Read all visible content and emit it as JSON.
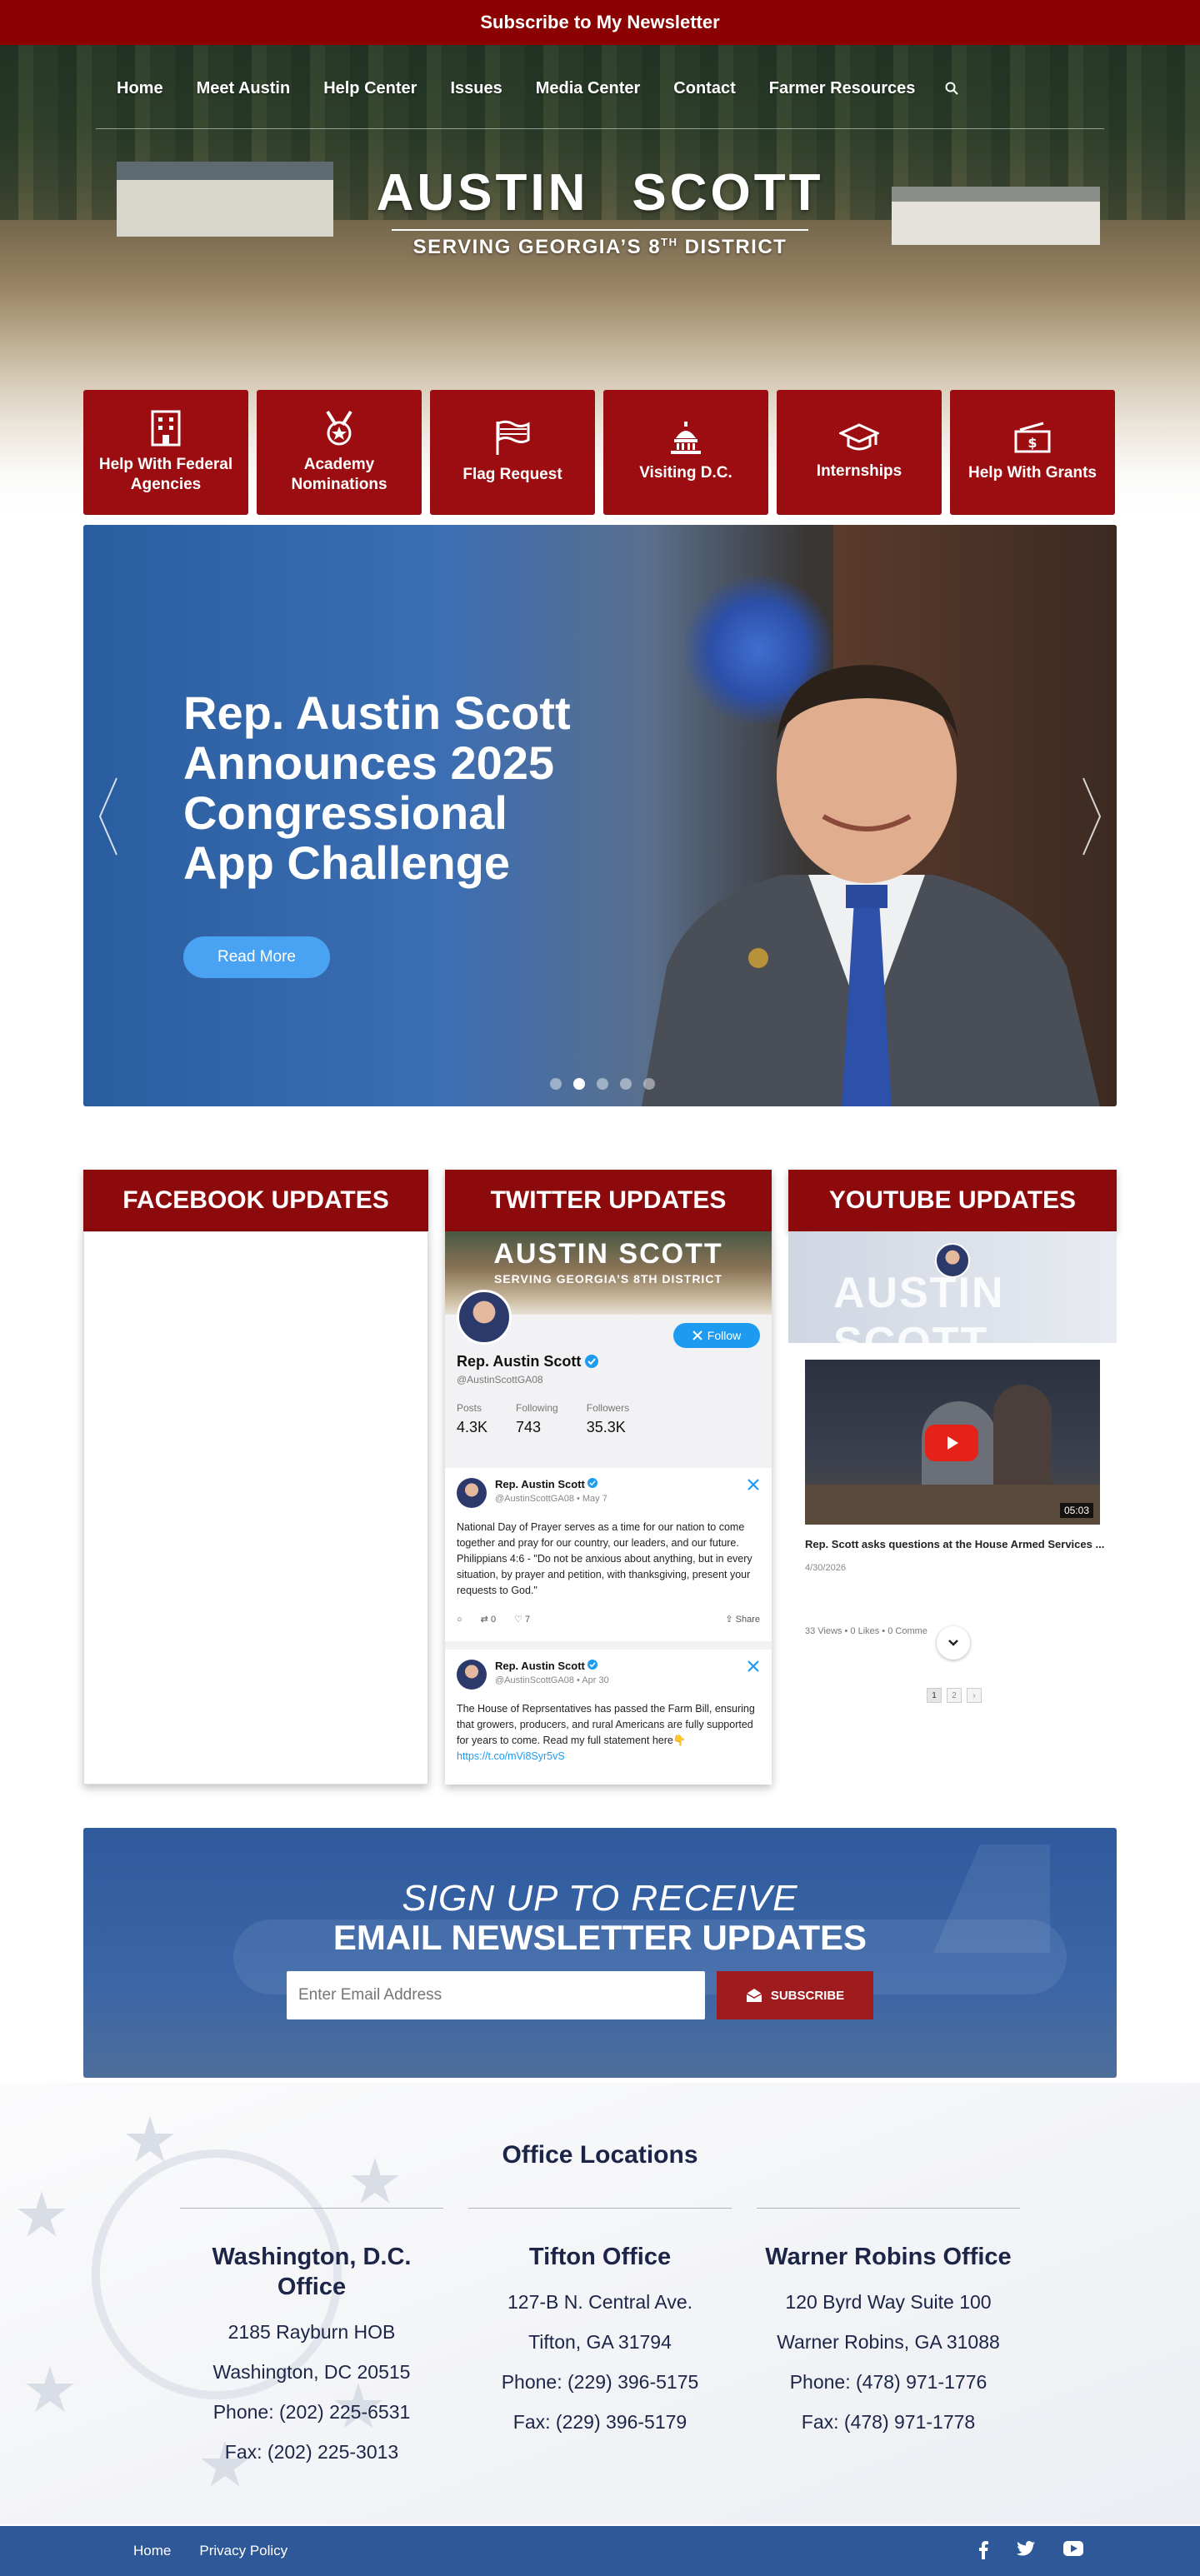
{
  "topbar": {
    "label": "Subscribe to My Newsletter"
  },
  "nav": {
    "items": [
      "Home",
      "Meet Austin",
      "Help Center",
      "Issues",
      "Media Center",
      "Contact",
      "Farmer Resources"
    ],
    "search_icon": "search-icon"
  },
  "logo": {
    "first": "AUSTIN",
    "last": "SCOTT",
    "tagline_pre": "SERVING GEORGIA’S 8",
    "tagline_sup": "TH",
    "tagline_post": " DISTRICT"
  },
  "quick_links": [
    {
      "label": "Help With Federal Agencies",
      "icon": "building-icon"
    },
    {
      "label": "Academy Nominations",
      "icon": "medal-icon"
    },
    {
      "label": "Flag Request",
      "icon": "flag-icon"
    },
    {
      "label": "Visiting D.C.",
      "icon": "capitol-icon"
    },
    {
      "label": "Internships",
      "icon": "graduation-cap-icon"
    },
    {
      "label": "Help With Grants",
      "icon": "money-icon"
    }
  ],
  "slider": {
    "title": "Rep. Austin Scott Announces 2025 Congressional App Challenge",
    "button": "Read More",
    "slide_count": 5,
    "active_slide": 2
  },
  "columns": {
    "facebook": "FACEBOOK UPDATES",
    "twitter": "TWITTER UPDATES",
    "youtube": "YOUTUBE UPDATES"
  },
  "twitter": {
    "banner_first": "AUSTIN",
    "banner_last": "SCOTT",
    "banner_tagline": "SERVING GEORGIA’S 8TH DISTRICT",
    "follow": "Follow",
    "name": "Rep. Austin Scott",
    "handle": "@AustinScottGA08",
    "stats": [
      {
        "label": "Posts",
        "value": "4.3K"
      },
      {
        "label": "Following",
        "value": "743"
      },
      {
        "label": "Followers",
        "value": "35.3K"
      }
    ],
    "tweets": [
      {
        "name": "Rep. Austin Scott",
        "meta": "@AustinScottGA08 • May 7",
        "text": "National Day of Prayer serves as a time for our nation to come together and pray for our country, our leaders, and our future. Philippians 4:6 - \"Do not be anxious about anything, but in every situation, by prayer and petition, with thanksgiving, present your requests to God.\"",
        "link": "",
        "retweets": "0",
        "likes": "7",
        "share": "Share"
      },
      {
        "name": "Rep. Austin Scott",
        "meta": "@AustinScottGA08 • Apr 30",
        "text": "The House of Reprsentatives has passed the Farm Bill, ensuring that growers, producers, and rural Americans are fully supported for years to come. Read my full statement here👇",
        "link": "https://t.co/mVi8Syr5vS"
      }
    ]
  },
  "youtube": {
    "banner": "AUSTIN SCOTT",
    "duration": "05:03",
    "title": "Rep. Scott asks questions at the House Armed Services ...",
    "date": "4/30/2026",
    "meta": "33 Views • 0 Likes • 0 Comme",
    "pages": [
      "1",
      "2",
      "›"
    ]
  },
  "signup": {
    "line1": "SIGN UP TO RECEIVE",
    "line2": "EMAIL NEWSLETTER UPDATES",
    "placeholder": "Enter Email Address",
    "button": "SUBSCRIBE"
  },
  "offices": {
    "title": "Office Locations",
    "list": [
      {
        "name": "Washington, D.C. Office",
        "lines": [
          "2185 Rayburn HOB",
          "Washington, DC 20515",
          "Phone: (202) 225-6531",
          "Fax: (202) 225-3013"
        ]
      },
      {
        "name": "Tifton Office",
        "lines": [
          "127-B N. Central Ave.",
          "Tifton, GA 31794",
          "Phone: (229) 396-5175",
          "Fax: (229) 396-5179"
        ]
      },
      {
        "name": "Warner Robins Office",
        "lines": [
          "120 Byrd Way Suite 100",
          "Warner Robins, GA 31088",
          "Phone: (478) 971-1776",
          "Fax: (478) 971-1778"
        ]
      }
    ]
  },
  "footer": {
    "links": [
      "Home",
      "Privacy Policy"
    ],
    "social": [
      "facebook-icon",
      "twitter-icon",
      "youtube-icon"
    ]
  },
  "colors": {
    "brand_red": "#8b0000",
    "brand_blue": "#2e5898",
    "accent_blue": "#4aa3f2"
  }
}
